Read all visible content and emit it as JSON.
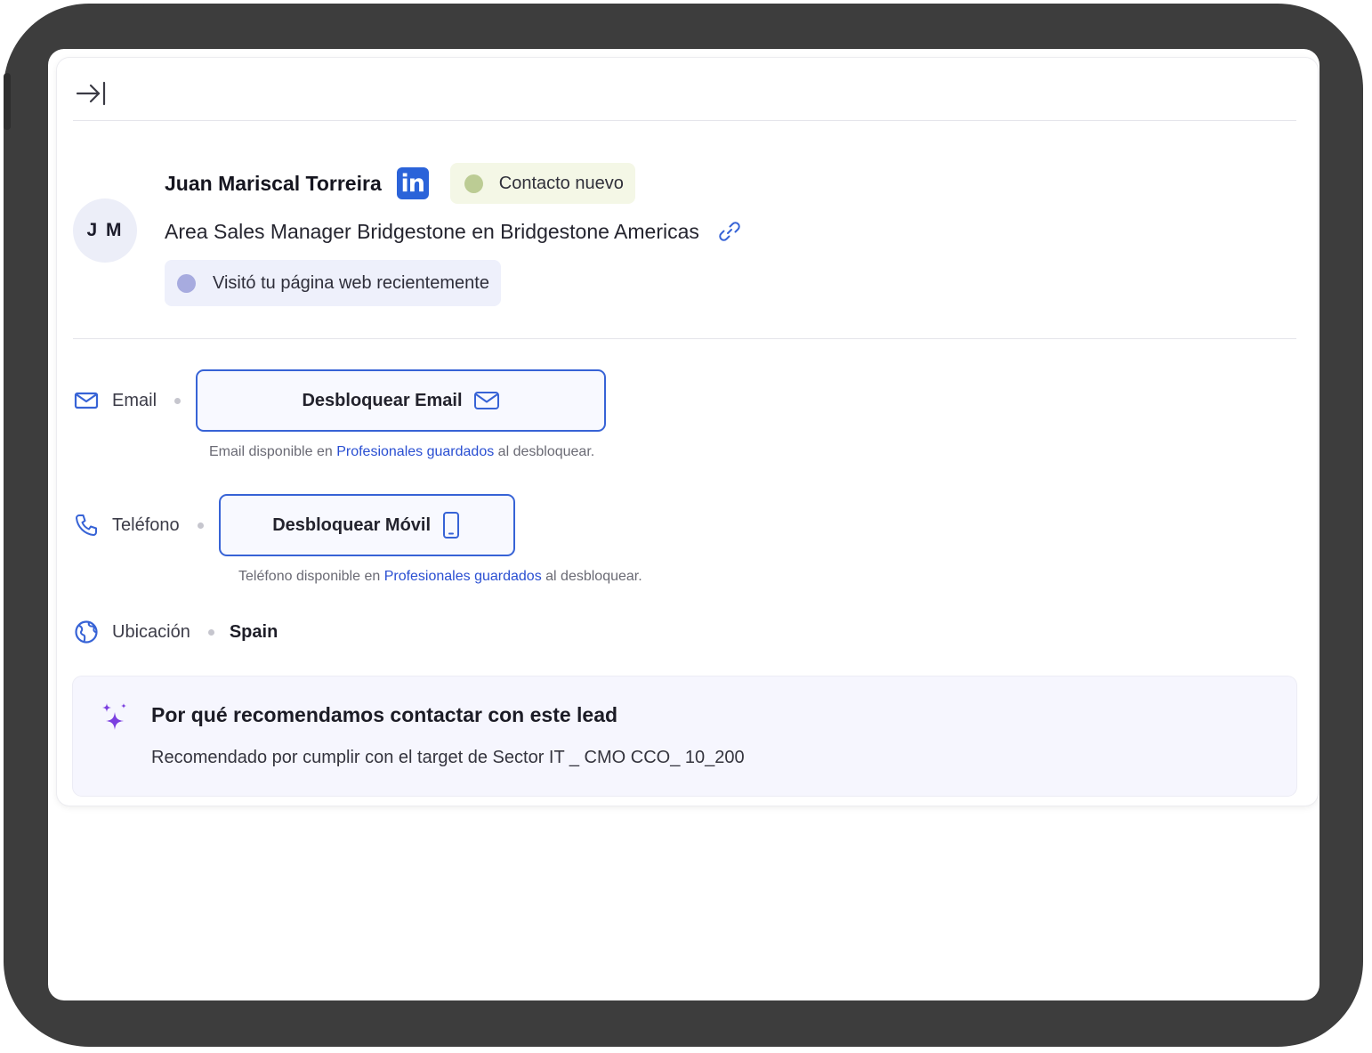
{
  "contact": {
    "initials": "J M",
    "name": "Juan Mariscal Torreira",
    "linkedin_label": "in",
    "status_badge": "Contacto nuevo",
    "job_title": "Area Sales Manager Bridgestone en Bridgestone Americas",
    "activity_badge": "Visitó tu página web recientemente"
  },
  "email": {
    "label": "Email",
    "button_label": "Desbloquear Email",
    "hint_prefix": "Email disponible en",
    "hint_link": "Profesionales guardados",
    "hint_suffix": "al desbloquear."
  },
  "phone": {
    "label": "Teléfono",
    "button_label": "Desbloquear Móvil",
    "hint_prefix": "Teléfono disponible en",
    "hint_link": "Profesionales guardados",
    "hint_suffix": "al desbloquear."
  },
  "location": {
    "label": "Ubicación",
    "value": "Spain"
  },
  "recommendation": {
    "title": "Por qué recomendamos contactar con este lead",
    "text": "Recomendado por cumplir con el target de Sector IT _ CMO CCO_ 10_200"
  },
  "colors": {
    "accent": "#3763d6",
    "link": "#2a4fd2",
    "linkedin": "#2b63d9",
    "status_new_dot": "#bccc94",
    "activity_dot": "#a7abdf",
    "sparkle": "#7b3fe0"
  },
  "icons": {
    "collapse": "arrow-right-to-bar-icon",
    "link": "link-icon",
    "email": "envelope-icon",
    "phone": "phone-icon",
    "mobile": "smartphone-icon",
    "location": "globe-icon",
    "recommendation": "sparkles-icon"
  }
}
